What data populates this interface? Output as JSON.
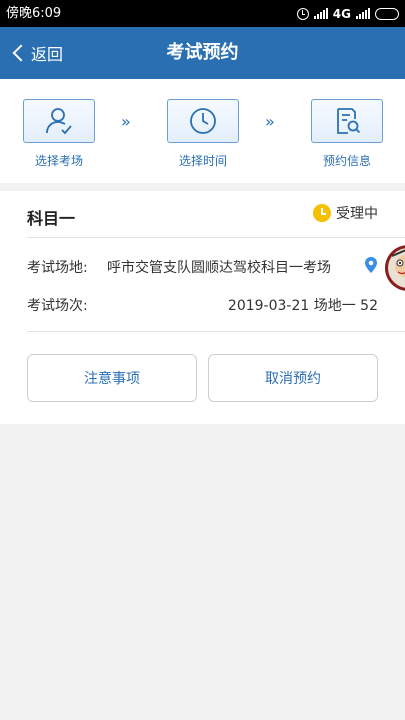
{
  "status_bar": {
    "time": "傍晚6:09",
    "network": "4G",
    "icons": [
      "alarm-icon",
      "signal-icon",
      "battery-icon"
    ]
  },
  "nav": {
    "back_label": "返回",
    "title": "考试预约",
    "color": "#2b6fb3"
  },
  "steps": [
    {
      "label": "选择考场",
      "icon": "user-check-icon"
    },
    {
      "label": "选择时间",
      "icon": "clock-icon"
    },
    {
      "label": "预约信息",
      "icon": "document-search-icon"
    }
  ],
  "step_arrow": "»",
  "booking": {
    "subject": "科目一",
    "status": "受理中",
    "status_color": "#f5c000",
    "venue_label": "考试场地:",
    "venue_value": "呼市交管支队圆顺达驾校科目一考场",
    "session_label": "考试场次:",
    "session_value": "2019-03-21 场地一 52"
  },
  "buttons": {
    "notice": "注意事项",
    "cancel": "取消预约"
  }
}
